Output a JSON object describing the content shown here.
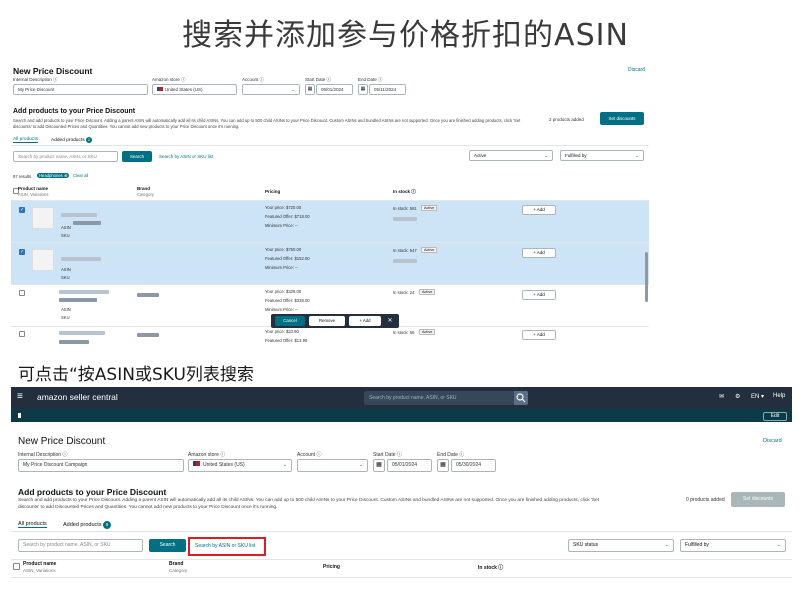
{
  "heading_top": "搜索并添加参与价格折扣的ASIN",
  "caption": "可点击“按ASIN或SKU列表搜索",
  "panel1": {
    "title": "New Price Discount",
    "discard": "Discard",
    "internal_label": "Internal Description ⓘ",
    "internal_value": "My Price Discount",
    "store_label": "Amazon store ⓘ",
    "store_value": "United States (US)",
    "account_label": "Account ⓘ",
    "account_value": "",
    "start_label": "Start Date ⓘ",
    "start_value": "05/01/2024",
    "end_label": "End Date ⓘ",
    "end_value": "05/11/2024",
    "section_title": "Add products to your Price Discount",
    "section_desc": "Search and add products to your Price Discount. Adding a parent ASIN will automatically add all its child ASINs. You can add up to 500 child ASINs to your Price Discount. Custom ASINs and bundled ASINs are not supported. Once you are finished adding products, click 'Set discounts' to add Discounted Prices and Quantities. You cannot add new products to your Price Discount once it's running.",
    "products_added": "2 products added",
    "set_discounts": "Set discounts",
    "tab_all": "All products",
    "tab_added": "Added products",
    "tab_added_count": "2",
    "search_placeholder": "Search by product name, ASIN, or SKU",
    "search_btn": "Search",
    "search_list_link": "Search by ASIN or SKU list",
    "status_select": "Active",
    "fulfilled_select": "Fulfilled by",
    "results": "97 results",
    "filter_chip": "Headphones ⊗",
    "clear_all": "Clear all",
    "col_product": "Product name",
    "col_product_sub": "ASIN, Variations",
    "col_brand": "Brand",
    "col_brand_sub": "Category",
    "col_pricing": "Pricing",
    "col_instock": "In stock ⓘ",
    "rows": [
      {
        "selected": true,
        "checked": "✓",
        "asin": "ASIN",
        "sku": "SKU",
        "your_price": "Your price: $720.00",
        "featured": "Featured Offer: $718.00",
        "min_price": "Minimum Price: --",
        "stock": "In stock: 581",
        "status": "Active",
        "add": "+ Add"
      },
      {
        "selected": true,
        "checked": "✓",
        "asin": "ASIN",
        "sku": "SKU",
        "your_price": "Your price: $750.00",
        "featured": "Featured Offer: $152.00",
        "min_price": "Minimum Price: --",
        "stock": "In stock: 547",
        "status": "Active",
        "add": "+ Add"
      },
      {
        "selected": false,
        "checked": "",
        "asin": "ASIN",
        "sku": "SKU",
        "your_price": "Your price: $328.00",
        "featured": "Featured Offer: $338.00",
        "min_price": "Minimum Price: --",
        "stock": "In stock: 24",
        "status": "Active",
        "add": "+ Add"
      },
      {
        "selected": false,
        "checked": "",
        "asin": "",
        "sku": "",
        "your_price": "Your price: $23.90",
        "featured": "Featured Offer: $13.98",
        "min_price": "",
        "stock": "In stock: 56",
        "status": "Active",
        "add": "+ Add"
      }
    ],
    "floatbar": {
      "cancel": "Cancel",
      "remove": "Remove",
      "add": "+ Add",
      "close": "✕"
    }
  },
  "panel2": {
    "logo": "amazon seller central",
    "menu_icon": "≡",
    "search_placeholder": "Search by product name, ASIN, or SKU",
    "lang": "EN ▾",
    "help": "Help",
    "edit": "Edit",
    "title": "New Price Discount",
    "discard": "Discard",
    "internal_label": "Internal Description ⓘ",
    "internal_value": "My Price Discount Campaign",
    "store_label": "Amazon store ⓘ",
    "store_value": "United States (US)",
    "account_label": "Account ⓘ",
    "account_value": "",
    "start_label": "Start Date ⓘ",
    "start_value": "05/01/2024",
    "end_label": "End Date ⓘ",
    "end_value": "05/30/2024",
    "section_title": "Add products to your Price Discount",
    "section_desc": "Search and add products to your Price Discount. Adding a parent ASIN will automatically add all its child ASINs. You can add up to 500 child ASINs to your Price Discount. Custom ASINs and bundled ASINs are not supported. Once you are finished adding products, click 'Set discounts' to add Discounted Prices and Quantities. You cannot add new products to your Price Discount once it's running.",
    "products_added": "0 products added",
    "set_discounts": "Set discounts",
    "tab_all": "All products",
    "tab_added": "Added products",
    "tab_added_count": "0",
    "search_btn": "Search",
    "search_list_link": "Search by ASIN or SKU list",
    "status_select": "SKU status",
    "fulfilled_select": "Fulfilled by",
    "col_product": "Product name",
    "col_product_sub": "ASIN, Variations",
    "col_brand": "Brand",
    "col_brand_sub": "Category",
    "col_pricing": "Pricing",
    "col_instock": "In stock ⓘ"
  },
  "colors": {
    "accent": "#007185",
    "selected_row": "#cde3f6",
    "nav": "#232f3e",
    "highlight": "#e01b24"
  }
}
